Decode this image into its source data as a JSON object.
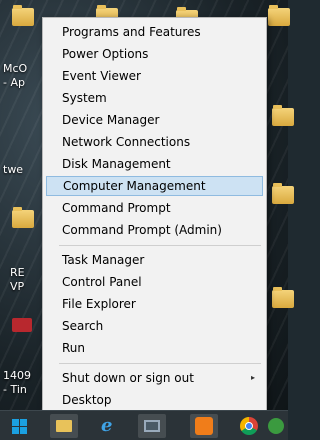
{
  "desktop": {
    "labels": [
      {
        "text": "McO"
      },
      {
        "text": "- Ap"
      },
      {
        "text": "twe"
      },
      {
        "text": "RE"
      },
      {
        "text": "VP"
      },
      {
        "text": "1409"
      },
      {
        "text": "- Tin"
      }
    ]
  },
  "menu": {
    "groups": [
      [
        "Programs and Features",
        "Power Options",
        "Event Viewer",
        "System",
        "Device Manager",
        "Network Connections",
        "Disk Management",
        "Computer Management",
        "Command Prompt",
        "Command Prompt (Admin)"
      ],
      [
        "Task Manager",
        "Control Panel",
        "File Explorer",
        "Search",
        "Run"
      ],
      [
        "Shut down or sign out",
        "Desktop"
      ]
    ],
    "selected": "Computer Management",
    "submenu_arrow": "▸"
  },
  "taskbar": {
    "icons": [
      "windows-start-icon",
      "file-explorer-icon",
      "internet-explorer-icon",
      "app-window-icon",
      "orange-app-icon",
      "chrome-icon",
      "green-app-icon"
    ]
  },
  "colors": {
    "menu_bg": "#f2f2f2",
    "selection_bg": "#cde2f3",
    "selection_border": "#8fbbe0",
    "taskbar": "#2b3338"
  }
}
